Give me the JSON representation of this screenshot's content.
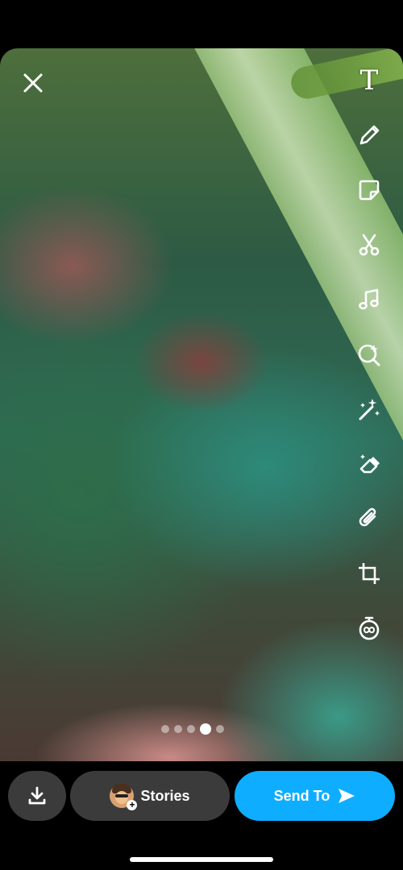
{
  "editor": {
    "close_icon": "close-icon",
    "tools": [
      {
        "name": "text-tool",
        "icon": "text-icon"
      },
      {
        "name": "draw-tool",
        "icon": "pencil-icon"
      },
      {
        "name": "sticker-tool",
        "icon": "sticker-icon"
      },
      {
        "name": "scissors-tool",
        "icon": "scissors-icon"
      },
      {
        "name": "music-tool",
        "icon": "music-note-icon"
      },
      {
        "name": "lens-tool",
        "icon": "lens-search-icon"
      },
      {
        "name": "magic-tool",
        "icon": "magic-wand-icon"
      },
      {
        "name": "eraser-tool",
        "icon": "eraser-icon"
      },
      {
        "name": "attachment-tool",
        "icon": "paperclip-icon"
      },
      {
        "name": "crop-tool",
        "icon": "crop-icon"
      },
      {
        "name": "timer-tool",
        "icon": "timer-icon"
      }
    ],
    "text_tool_glyph": "T",
    "pages": {
      "count": 5,
      "active_index": 3
    }
  },
  "bottom_bar": {
    "save_icon": "download-icon",
    "stories_label": "Stories",
    "send_label": "Send To",
    "send_icon": "send-arrow-icon"
  },
  "colors": {
    "send_button": "#0fadff",
    "secondary_button": "#3b3b3b",
    "background": "#000000"
  }
}
